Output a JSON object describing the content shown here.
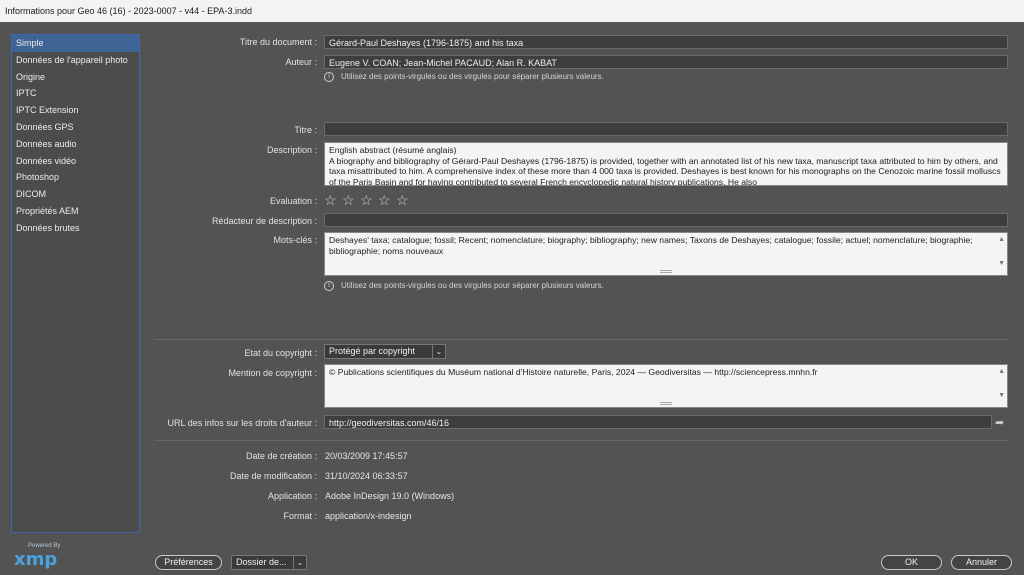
{
  "window": {
    "title": "Informations pour Geo 46 (16) - 2023-0007 - v44 - EPA-3.indd"
  },
  "sidebar": {
    "items": [
      {
        "label": "Simple"
      },
      {
        "label": "Données de l'appareil photo"
      },
      {
        "label": "Origine"
      },
      {
        "label": "IPTC"
      },
      {
        "label": "IPTC Extension"
      },
      {
        "label": "Données GPS"
      },
      {
        "label": "Données audio"
      },
      {
        "label": "Données vidéo"
      },
      {
        "label": "Photoshop"
      },
      {
        "label": "DICOM"
      },
      {
        "label": "Propriétés AEM"
      },
      {
        "label": "Données brutes"
      }
    ],
    "selected": "Simple"
  },
  "xmp": {
    "powered_by": "Powered By",
    "logo": "xmp"
  },
  "form": {
    "doc_title_label": "Titre du document :",
    "doc_title_value": "Gérard-Paul Deshayes (1796-1875) and his taxa",
    "author_label": "Auteur :",
    "author_value": "Eugene V. COAN; Jean-Michel PACAUD; Alan R. KABAT",
    "hint": "Utilisez des points-virgules ou des virgules pour séparer plusieurs valeurs.",
    "title_label": "Titre :",
    "title_value": "",
    "description_label": "Description :",
    "description_value": "English abstract (résumé anglais)\nA biography and bibliography of Gérard-Paul Deshayes (1796-1875) is provided, together with an annotated list of his new taxa, manuscript taxa attributed to him by others, and taxa misattributed to him. A comprehensive index of these more than 4 000 taxa is provided. Deshayes is best known for his monographs on the Cenozoic marine fossil molluscs of the Paris Basin and for having contributed to several French encyclopedic natural history publications. He also",
    "rating_label": "Evaluation :",
    "rating_value": 0,
    "rating_max": 5,
    "desc_writer_label": "Rédacteur de description :",
    "desc_writer_value": "",
    "keywords_label": "Mots-clés :",
    "keywords_value": "Deshayes' taxa; catalogue; fossil; Recent; nomenclature; biography; bibliography; new names; Taxons de Deshayes; catalogue; fossile; actuel; nomenclature; biographie; bibliographie; noms nouveaux",
    "copyright_status_label": "Etat du copyright :",
    "copyright_status_value": "Protégé par copyright",
    "copyright_notice_label": "Mention de copyright :",
    "copyright_notice_value": "© Publications scientifiques du Muséum national d'Histoire naturelle, Paris, 2024 — Geodiversitas — http://sciencepress.mnhn.fr",
    "rights_url_label": "URL des infos sur les droits d'auteur :",
    "rights_url_value": "http://geodiversitas.com/46/16",
    "created_label": "Date de création :",
    "created_value": "20/03/2009 17:45:57",
    "modified_label": "Date de modification :",
    "modified_value": "31/10/2024 06:33:57",
    "application_label": "Application :",
    "application_value": "Adobe InDesign 19.0 (Windows)",
    "format_label": "Format :",
    "format_value": "application/x-indesign"
  },
  "footer": {
    "preferences_label": "Préférences",
    "folder_label": "Dossier de...",
    "ok_label": "OK",
    "cancel_label": "Annuler"
  },
  "icons": {
    "info": "info-icon",
    "star": "star-outline-icon",
    "dropdown": "chevron-down-icon",
    "share": "share-arrow-icon"
  }
}
